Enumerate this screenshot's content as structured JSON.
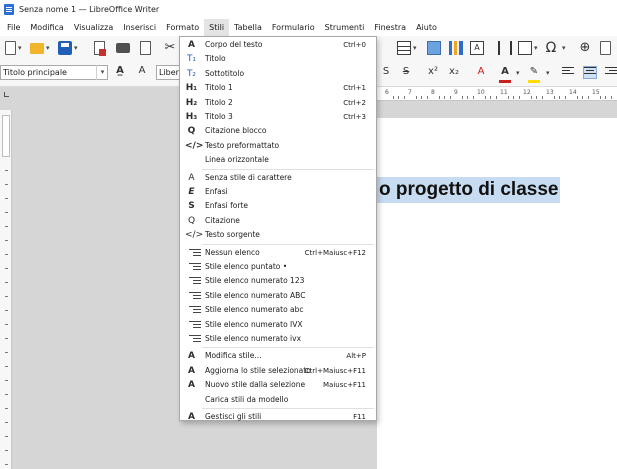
{
  "window": {
    "title": "Senza nome 1 — LibreOffice Writer"
  },
  "menubar": {
    "items": [
      "File",
      "Modifica",
      "Visualizza",
      "Inserisci",
      "Formato",
      "Stili",
      "Tabella",
      "Formulario",
      "Strumenti",
      "Finestra",
      "Aiuto"
    ],
    "active": "Stili"
  },
  "toolbar": {
    "paragraph_style": "Titolo principale",
    "font_name": "Libera",
    "format_buttons": [
      "S",
      "S",
      "x²",
      "x₂"
    ],
    "special_char_glyph": "Ω",
    "colors": {
      "font_color": "#c9211e",
      "highlight": "#ffdd00",
      "accent": "#2b6fd6"
    }
  },
  "ruler": {
    "numbers": [
      "6",
      "7",
      "8",
      "9",
      "10",
      "11",
      "12",
      "13",
      "14",
      "15"
    ]
  },
  "document": {
    "heading_text": "o progetto di classe"
  },
  "styles_menu": {
    "paragraph_items": [
      {
        "label": "Corpo del testo",
        "shortcut": "Ctrl+0",
        "icon": "A",
        "icon_name": "body-text-icon"
      },
      {
        "label": "Titolo",
        "shortcut": "",
        "icon": "T₁",
        "icon_name": "title-icon"
      },
      {
        "label": "Sottotitolo",
        "shortcut": "",
        "icon": "T₂",
        "icon_name": "subtitle-icon"
      },
      {
        "label": "Titolo 1",
        "shortcut": "Ctrl+1",
        "icon": "H₁",
        "icon_name": "heading-1-icon"
      },
      {
        "label": "Titolo 2",
        "shortcut": "Ctrl+2",
        "icon": "H₂",
        "icon_name": "heading-2-icon"
      },
      {
        "label": "Titolo 3",
        "shortcut": "Ctrl+3",
        "icon": "H₃",
        "icon_name": "heading-3-icon"
      },
      {
        "label": "Citazione blocco",
        "shortcut": "",
        "icon": "Q",
        "icon_name": "block-quote-icon"
      },
      {
        "label": "Testo preformattato",
        "shortcut": "",
        "icon": "</>",
        "icon_name": "preformatted-icon"
      },
      {
        "label": "Linea orizzontale",
        "shortcut": "",
        "icon": "",
        "icon_name": ""
      }
    ],
    "character_items": [
      {
        "label": "Senza stile di carattere",
        "shortcut": "",
        "icon": "A",
        "icon_name": "no-char-style-icon"
      },
      {
        "label": "Enfasi",
        "shortcut": "",
        "icon": "E",
        "icon_name": "emphasis-icon"
      },
      {
        "label": "Enfasi forte",
        "shortcut": "",
        "icon": "S",
        "icon_name": "strong-emphasis-icon"
      },
      {
        "label": "Citazione",
        "shortcut": "",
        "icon": "Q",
        "icon_name": "quotation-icon"
      },
      {
        "label": "Testo sorgente",
        "shortcut": "",
        "icon": "</>",
        "icon_name": "source-text-icon"
      }
    ],
    "list_items": [
      {
        "label": "Nessun elenco",
        "shortcut": "Ctrl+Maiusc+F12",
        "icon_name": "no-list-icon"
      },
      {
        "label": "Stile elenco puntato •",
        "shortcut": "",
        "icon_name": "bullet-list-icon"
      },
      {
        "label": "Stile elenco numerato 123",
        "shortcut": "",
        "icon_name": "numbered-list-123-icon"
      },
      {
        "label": "Stile elenco numerato ABC",
        "shortcut": "",
        "icon_name": "numbered-list-abc-upper-icon"
      },
      {
        "label": "Stile elenco numerato abc",
        "shortcut": "",
        "icon_name": "numbered-list-abc-lower-icon"
      },
      {
        "label": "Stile elenco numerato IVX",
        "shortcut": "",
        "icon_name": "numbered-list-ivx-upper-icon"
      },
      {
        "label": "Stile elenco numerato ivx",
        "shortcut": "",
        "icon_name": "numbered-list-ivx-lower-icon"
      }
    ],
    "manage_items": [
      {
        "label": "Modifica stile...",
        "shortcut": "Alt+P",
        "icon_name": "edit-style-icon"
      },
      {
        "label": "Aggiorna lo stile selezionato",
        "shortcut": "Ctrl+Maiusc+F11",
        "icon_name": "update-style-icon"
      },
      {
        "label": "Nuovo stile dalla selezione",
        "shortcut": "Maiusc+F11",
        "icon_name": "new-style-icon"
      },
      {
        "label": "Carica stili da modello",
        "shortcut": "",
        "icon_name": ""
      }
    ],
    "footer_item": {
      "label": "Gestisci gli stili",
      "shortcut": "F11",
      "icon_name": "manage-styles-icon"
    }
  }
}
